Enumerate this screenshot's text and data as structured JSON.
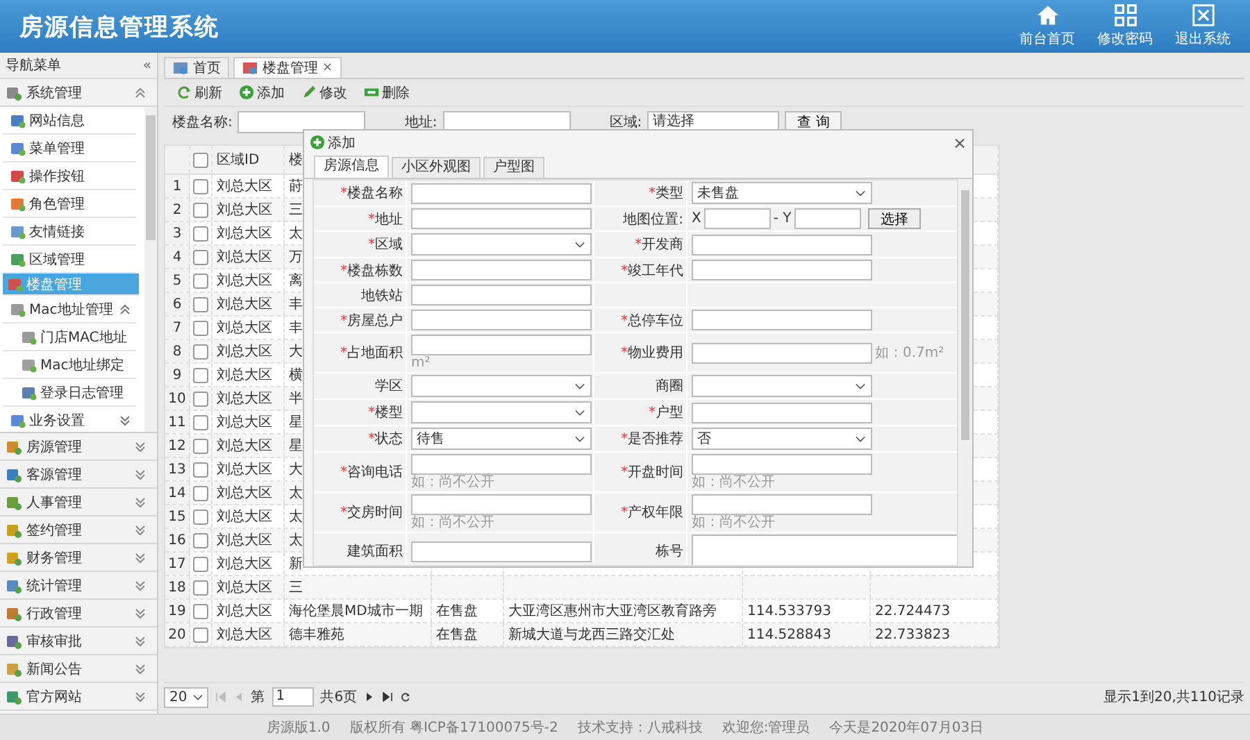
{
  "header": {
    "title": "房源信息管理系统",
    "actions": [
      {
        "kind": "home",
        "label": "前台首页"
      },
      {
        "kind": "password",
        "label": "修改密码"
      },
      {
        "kind": "exit",
        "label": "退出系统"
      }
    ]
  },
  "sidebar": {
    "title": "导航菜单",
    "collapse": "«",
    "panels": [
      {
        "label": "系统管理",
        "expanded": true,
        "items": [
          {
            "label": "网站信息",
            "selected": false
          },
          {
            "label": "菜单管理",
            "selected": false
          },
          {
            "label": "操作按钮",
            "selected": false
          },
          {
            "label": "角色管理",
            "selected": false
          },
          {
            "label": "友情链接",
            "selected": false
          },
          {
            "label": "区域管理",
            "selected": false
          },
          {
            "label": "楼盘管理",
            "selected": true
          },
          {
            "label": "Mac地址管理",
            "selected": false,
            "expanded": true,
            "children": [
              {
                "label": "门店MAC地址",
                "selected": false
              },
              {
                "label": "Mac地址绑定",
                "selected": false
              },
              {
                "label": "登录日志管理",
                "selected": false
              }
            ]
          },
          {
            "label": "业务设置",
            "selected": false,
            "expanded": false
          }
        ]
      },
      {
        "label": "房源管理",
        "expanded": false
      },
      {
        "label": "客源管理",
        "expanded": false
      },
      {
        "label": "人事管理",
        "expanded": false
      },
      {
        "label": "签约管理",
        "expanded": false
      },
      {
        "label": "财务管理",
        "expanded": false
      },
      {
        "label": "统计管理",
        "expanded": false
      },
      {
        "label": "行政管理",
        "expanded": false
      },
      {
        "label": "审核审批",
        "expanded": false
      },
      {
        "label": "新闻公告",
        "expanded": false
      },
      {
        "label": "官方网站",
        "expanded": false
      }
    ]
  },
  "tabs": [
    {
      "label": "首页",
      "selected": false
    },
    {
      "label": "楼盘管理",
      "selected": true,
      "close": "×"
    }
  ],
  "toolbar": [
    {
      "kind": "refresh",
      "label": "刷新"
    },
    {
      "kind": "add",
      "label": "添加"
    },
    {
      "kind": "edit",
      "label": "修改"
    },
    {
      "kind": "delete",
      "label": "删除"
    }
  ],
  "search": {
    "fields": [
      {
        "kind": "input",
        "label": "楼盘名称:"
      },
      {
        "kind": "input",
        "label": "地址:"
      },
      {
        "kind": "select",
        "label": "区域:",
        "value": "请选择"
      }
    ],
    "button": "查 询"
  },
  "table": {
    "all_checked": false,
    "columns": [
      "区域ID",
      "楼"
    ],
    "rows": [
      {
        "num": "1",
        "checked": false,
        "cells": [
          "刘总大区",
          "莳"
        ]
      },
      {
        "num": "2",
        "checked": false,
        "cells": [
          "刘总大区",
          "三"
        ]
      },
      {
        "num": "3",
        "checked": false,
        "cells": [
          "刘总大区",
          "太"
        ]
      },
      {
        "num": "4",
        "checked": false,
        "cells": [
          "刘总大区",
          "万"
        ]
      },
      {
        "num": "5",
        "checked": false,
        "cells": [
          "刘总大区",
          "离"
        ]
      },
      {
        "num": "6",
        "checked": false,
        "cells": [
          "刘总大区",
          "丰"
        ]
      },
      {
        "num": "7",
        "checked": false,
        "cells": [
          "刘总大区",
          "丰"
        ]
      },
      {
        "num": "8",
        "checked": false,
        "cells": [
          "刘总大区",
          "大"
        ]
      },
      {
        "num": "9",
        "checked": false,
        "cells": [
          "刘总大区",
          "横"
        ]
      },
      {
        "num": "10",
        "checked": false,
        "cells": [
          "刘总大区",
          "半"
        ]
      },
      {
        "num": "11",
        "checked": false,
        "cells": [
          "刘总大区",
          "星"
        ]
      },
      {
        "num": "12",
        "checked": false,
        "cells": [
          "刘总大区",
          "星"
        ]
      },
      {
        "num": "13",
        "checked": false,
        "cells": [
          "刘总大区",
          "大"
        ]
      },
      {
        "num": "14",
        "checked": false,
        "cells": [
          "刘总大区",
          "太"
        ]
      },
      {
        "num": "15",
        "checked": false,
        "cells": [
          "刘总大区",
          "太"
        ]
      },
      {
        "num": "16",
        "checked": false,
        "cells": [
          "刘总大区",
          "太"
        ]
      },
      {
        "num": "17",
        "checked": false,
        "cells": [
          "刘总大区",
          "新"
        ]
      },
      {
        "num": "18",
        "checked": false,
        "cells": [
          "刘总大区",
          "三"
        ]
      },
      {
        "num": "19",
        "checked": false,
        "cells": [
          "刘总大区",
          "海伦堡晨MD城市一期",
          "在售盘",
          "大亚湾区惠州市大亚湾区教育路旁",
          "114.533793",
          "22.724473"
        ]
      },
      {
        "num": "20",
        "checked": false,
        "cells": [
          "刘总大区",
          "德丰雅苑",
          "在售盘",
          "新城大道与龙西三路交汇处",
          "114.528843",
          "22.733823"
        ]
      }
    ]
  },
  "pager": {
    "page_size": "20",
    "page_label": "第",
    "page": "1",
    "total_pages": "共6页",
    "summary": "显示1到20,共110记录"
  },
  "footer": [
    "房源版1.0",
    "版权所有 粤ICP备17100075号-2",
    "技术支持：八戒科技",
    "欢迎您:管理员",
    "今天是2020年07月03日"
  ],
  "dialog": {
    "title": "添加",
    "close": "×",
    "tabs": [
      {
        "label": "房源信息",
        "selected": true
      },
      {
        "label": "小区外观图",
        "selected": false
      },
      {
        "label": "户型图",
        "selected": false
      }
    ],
    "rows": [
      [
        {
          "mark": "*",
          "label": "楼盘名称",
          "kind": "input"
        },
        {
          "mark": "*",
          "label": "类型",
          "kind": "select",
          "value": "未售盘"
        }
      ],
      [
        {
          "mark": "*",
          "label": "地址",
          "kind": "input"
        },
        {
          "label": "地图位置:",
          "kind": "xy",
          "x_label": "X",
          "y_label": "- Y",
          "button": "选择"
        }
      ],
      [
        {
          "mark": "*",
          "label": "区域",
          "kind": "select"
        },
        {
          "mark": "*",
          "label": "开发商",
          "kind": "input"
        }
      ],
      [
        {
          "mark": "*",
          "label": "楼盘栋数",
          "kind": "input"
        },
        {
          "mark": "*",
          "label": "竣工年代",
          "kind": "input"
        }
      ],
      [
        {
          "label": "地铁站",
          "kind": "input"
        },
        {
          "kind": "empty"
        }
      ],
      [
        {
          "mark": "*",
          "label": "房屋总户",
          "kind": "input"
        },
        {
          "mark": "*",
          "label": "总停车位",
          "kind": "input"
        }
      ],
      [
        {
          "mark": "*",
          "label": "占地面积",
          "kind": "input",
          "hint": "m²",
          "hint_below": true
        },
        {
          "mark": "*",
          "label": "物业费用",
          "kind": "input",
          "hint": "如：0.7m²",
          "hint_below": false
        }
      ],
      [
        {
          "label": "学区",
          "kind": "select"
        },
        {
          "label": "商圈",
          "kind": "select"
        }
      ],
      [
        {
          "mark": "*",
          "label": "楼型",
          "kind": "select"
        },
        {
          "mark": "*",
          "label": "户型",
          "kind": "input"
        }
      ],
      [
        {
          "mark": "*",
          "label": "状态",
          "kind": "select",
          "value": "待售"
        },
        {
          "mark": "*",
          "label": "是否推荐",
          "kind": "select",
          "value": "否"
        }
      ],
      [
        {
          "mark": "*",
          "label": "咨询电话",
          "kind": "input",
          "hint": "如：尚不公开",
          "hint_below": true
        },
        {
          "mark": "*",
          "label": "开盘时间",
          "kind": "input",
          "hint": "如：尚不公开",
          "hint_below": true
        }
      ],
      [
        {
          "mark": "*",
          "label": "交房时间",
          "kind": "input",
          "hint": "如：尚不公开",
          "hint_below": true
        },
        {
          "mark": "*",
          "label": "产权年限",
          "kind": "input",
          "hint": "如：尚不公开",
          "hint_below": true
        }
      ],
      [
        {
          "label": "建筑面积",
          "kind": "input"
        },
        {
          "label": "栋号",
          "kind": "textarea"
        }
      ]
    ]
  }
}
